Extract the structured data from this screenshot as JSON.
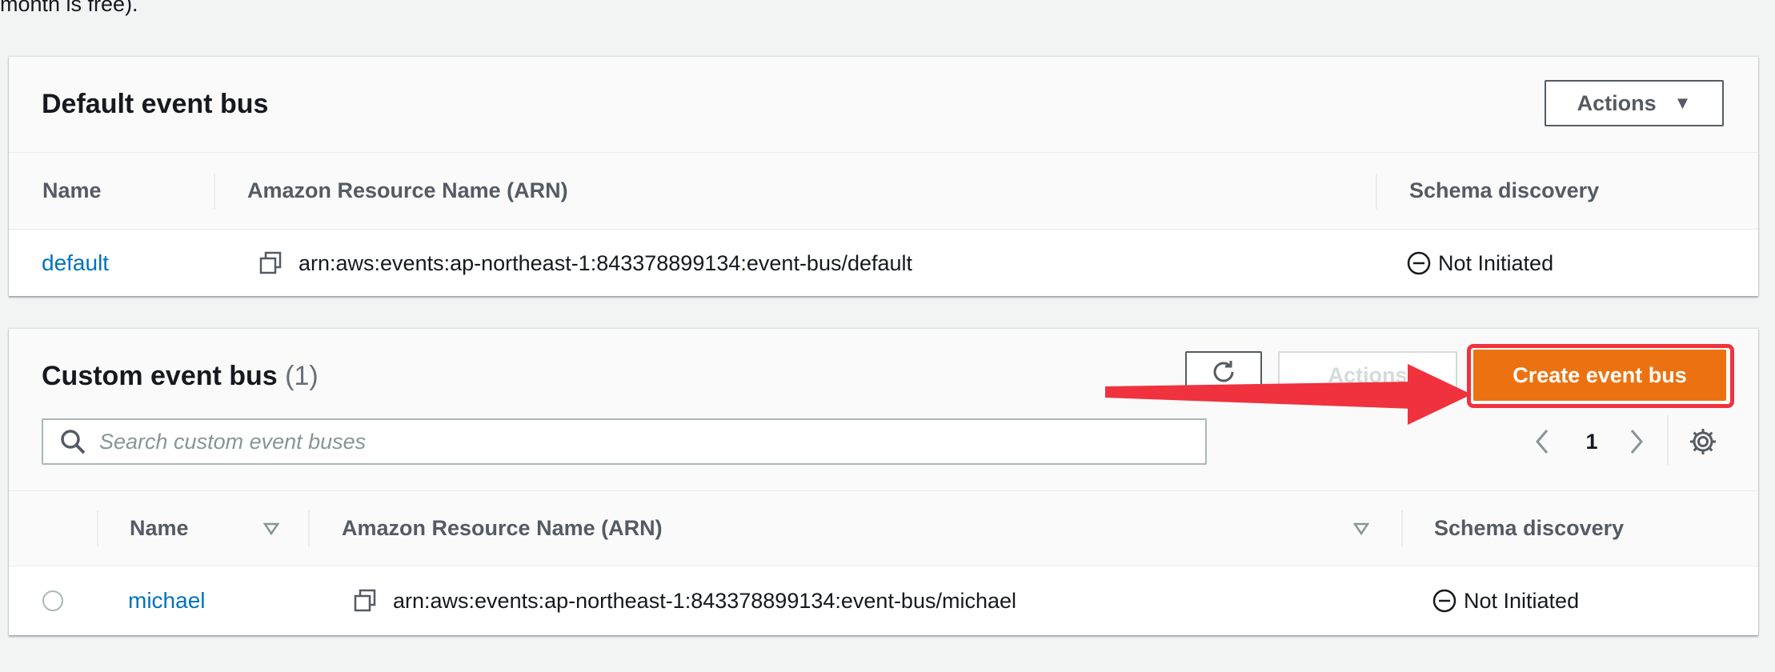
{
  "intro": {
    "text": "month is free)."
  },
  "default_bus": {
    "title": "Default event bus",
    "actions_label": "Actions",
    "columns": {
      "name": "Name",
      "arn": "Amazon Resource Name (ARN)",
      "schema": "Schema discovery"
    },
    "rows": [
      {
        "name": "default",
        "arn": "arn:aws:events:ap-northeast-1:843378899134:event-bus/default",
        "schema_discovery": "Not Initiated"
      }
    ]
  },
  "custom_bus": {
    "title": "Custom event bus",
    "count": "(1)",
    "actions_label": "Actions",
    "create_label": "Create event bus",
    "search_placeholder": "Search custom event buses",
    "pagination": {
      "current_page": "1"
    },
    "columns": {
      "name": "Name",
      "arn": "Amazon Resource Name (ARN)",
      "schema": "Schema discovery"
    },
    "rows": [
      {
        "name": "michael",
        "arn": "arn:aws:events:ap-northeast-1:843378899134:event-bus/michael",
        "schema_discovery": "Not Initiated"
      }
    ]
  },
  "colors": {
    "primary": "#ec7211",
    "link": "#0073bb",
    "annotation": "#f0323f"
  }
}
